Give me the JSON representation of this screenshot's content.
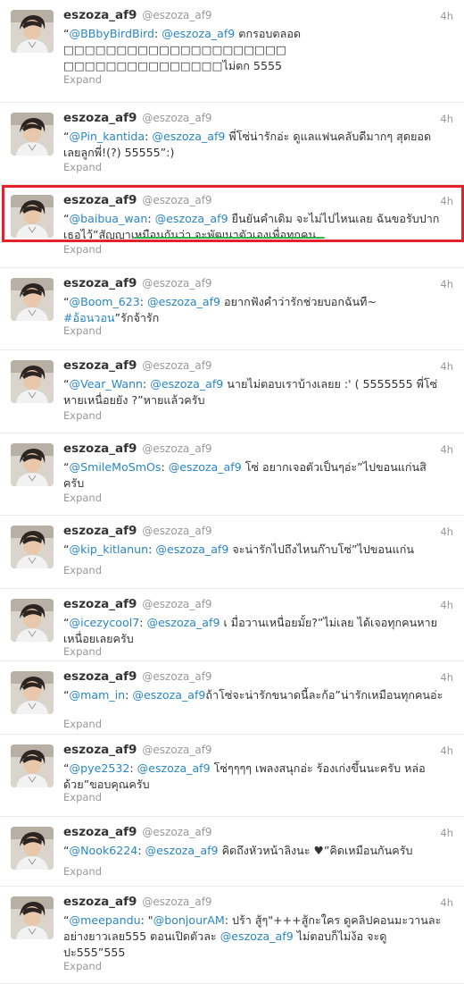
{
  "tweets": [
    {
      "name": "eszoza_af9",
      "handle": "@eszoza_af9",
      "time": "4h",
      "expand": "Expand",
      "lines": [
        [
          {
            "t": "“",
            "c": "p"
          },
          {
            "t": "@BBbyBirdBird",
            "c": "m"
          },
          {
            "t": ": ",
            "c": "p"
          },
          {
            "t": "@eszoza_af9",
            "c": "m"
          },
          {
            "t": " ตกรอบตลอด",
            "c": "p"
          }
        ],
        [
          {
            "t": "□□□□□□□□□□□□□□□□□□□□□",
            "c": "p"
          }
        ],
        [
          {
            "t": "□□□□□□□□□□□□□□□ไม่ตก 5555",
            "c": "p"
          }
        ]
      ]
    },
    {
      "name": "eszoza_af9",
      "handle": "@eszoza_af9",
      "time": "4h",
      "expand": "Expand",
      "lines": [
        [
          {
            "t": "“",
            "c": "p"
          },
          {
            "t": "@Pin_kantida",
            "c": "m"
          },
          {
            "t": ": ",
            "c": "p"
          },
          {
            "t": "@eszoza_af9",
            "c": "m"
          },
          {
            "t": " พี่โซ่น่ารักอ่ะ ดูแลแฟนคลับดีมากๆ สุดยอด",
            "c": "p"
          }
        ],
        [
          {
            "t": "เลยลูกพี่!(?) 55555”:)",
            "c": "p"
          }
        ]
      ]
    },
    {
      "name": "eszoza_af9",
      "handle": "@eszoza_af9",
      "time": "4h",
      "expand": "Expand",
      "lines": [
        [
          {
            "t": "“",
            "c": "p"
          },
          {
            "t": "@baibua_wan",
            "c": "m"
          },
          {
            "t": ": ",
            "c": "p"
          },
          {
            "t": "@eszoza_af9",
            "c": "m"
          },
          {
            "t": " ยืนยันคำเดิม จะไม่ไปไหนเลย ฉันขอรับปาก",
            "c": "p"
          }
        ],
        [
          {
            "t": "เธอไว้”สัญญาเหมือนกันว่า จะพัฒนาตัวเองเพื่อทุกคน",
            "c": "p"
          }
        ]
      ]
    },
    {
      "name": "eszoza_af9",
      "handle": "@eszoza_af9",
      "time": "4h",
      "expand": "Expand",
      "lines": [
        [
          {
            "t": "“",
            "c": "p"
          },
          {
            "t": "@Boom_623",
            "c": "m"
          },
          {
            "t": ": ",
            "c": "p"
          },
          {
            "t": "@eszoza_af9",
            "c": "m"
          },
          {
            "t": " อยากฟังคำว่ารักช่วยบอกฉันที~",
            "c": "p"
          }
        ],
        [
          {
            "t": "#อ้อนวอน",
            "c": "h"
          },
          {
            "t": "”รักจ้ารัก",
            "c": "p"
          }
        ]
      ]
    },
    {
      "name": "eszoza_af9",
      "handle": "@eszoza_af9",
      "time": "4h",
      "expand": "Expand",
      "lines": [
        [
          {
            "t": "“",
            "c": "p"
          },
          {
            "t": "@Vear_Wann",
            "c": "m"
          },
          {
            "t": ": ",
            "c": "p"
          },
          {
            "t": "@eszoza_af9",
            "c": "m"
          },
          {
            "t": " นายไม่ตอบเราบ้างเลยย :' ( 5555555 พี่โซ่",
            "c": "p"
          }
        ],
        [
          {
            "t": "หายเหนื่อยยัง ?”หายแล้วครับ",
            "c": "p"
          }
        ]
      ]
    },
    {
      "name": "eszoza_af9",
      "handle": "@eszoza_af9",
      "time": "4h",
      "expand": "Expand",
      "lines": [
        [
          {
            "t": "“",
            "c": "p"
          },
          {
            "t": "@SmileMoSmOs",
            "c": "m"
          },
          {
            "t": ": ",
            "c": "p"
          },
          {
            "t": "@eszoza_af9",
            "c": "m"
          },
          {
            "t": " โซ่ อยากเจอตัวเป็นๆอ่ะ”ไปขอนแก่นสิ",
            "c": "p"
          }
        ],
        [
          {
            "t": "ครับ",
            "c": "p"
          }
        ]
      ]
    },
    {
      "name": "eszoza_af9",
      "handle": "@eszoza_af9",
      "time": "4h",
      "expand": "Expand",
      "lines": [
        [
          {
            "t": "“",
            "c": "p"
          },
          {
            "t": "@kip_kitlanun",
            "c": "m"
          },
          {
            "t": ": ",
            "c": "p"
          },
          {
            "t": "@eszoza_af9",
            "c": "m"
          },
          {
            "t": " จะน่ารักไปถึงไหนก๊าบโซ่”ไปขอนแก่น",
            "c": "p"
          }
        ]
      ]
    },
    {
      "name": "eszoza_af9",
      "handle": "@eszoza_af9",
      "time": "4h",
      "expand": "Expand",
      "lines": [
        [
          {
            "t": "“",
            "c": "p"
          },
          {
            "t": "@icezycool7",
            "c": "m"
          },
          {
            "t": ": ",
            "c": "p"
          },
          {
            "t": "@eszoza_af9",
            "c": "m"
          },
          {
            "t": " เ มื่อวานเหนื่อยมั้ย?”ไม่เลย ได้เจอทุกคนหาย",
            "c": "p"
          }
        ],
        [
          {
            "t": "เหนื่อยเลยครับ",
            "c": "p"
          }
        ]
      ]
    },
    {
      "name": "eszoza_af9",
      "handle": "@eszoza_af9",
      "time": "4h",
      "expand": "Expand",
      "lines": [
        [
          {
            "t": "“",
            "c": "p"
          },
          {
            "t": "@mam_in",
            "c": "m"
          },
          {
            "t": ": ",
            "c": "p"
          },
          {
            "t": "@eszoza_af9",
            "c": "m"
          },
          {
            "t": "ถ้าโซ่จะน่ารักขนาดนี้ละก้อ”น่ารักเหมือนทุกคนอ่ะ",
            "c": "p"
          }
        ]
      ]
    },
    {
      "name": "eszoza_af9",
      "handle": "@eszoza_af9",
      "time": "4h",
      "expand": "Expand",
      "lines": [
        [
          {
            "t": "“",
            "c": "p"
          },
          {
            "t": "@pye2532",
            "c": "m"
          },
          {
            "t": ": ",
            "c": "p"
          },
          {
            "t": "@eszoza_af9",
            "c": "m"
          },
          {
            "t": " โซ่ๆๆๆๆ เพลงสนุกอ่ะ ร้องเก่งขึ้นนะครับ หล่อ",
            "c": "p"
          }
        ],
        [
          {
            "t": "ด้วย”ขอบคุณครับ",
            "c": "p"
          }
        ]
      ]
    },
    {
      "name": "eszoza_af9",
      "handle": "@eszoza_af9",
      "time": "4h",
      "expand": "Expand",
      "lines": [
        [
          {
            "t": "“",
            "c": "p"
          },
          {
            "t": "@Nook6224",
            "c": "m"
          },
          {
            "t": ": ",
            "c": "p"
          },
          {
            "t": "@eszoza_af9",
            "c": "m"
          },
          {
            "t": " คิดถึงหัวหน้าลิงนะ ♥”คิดเหมือนกันครับ",
            "c": "p"
          }
        ]
      ]
    },
    {
      "name": "eszoza_af9",
      "handle": "@eszoza_af9",
      "time": "4h",
      "expand": "Expand",
      "lines": [
        [
          {
            "t": "“",
            "c": "p"
          },
          {
            "t": "@meepandu",
            "c": "m"
          },
          {
            "t": ": \"",
            "c": "p"
          },
          {
            "t": "@bonjourAM",
            "c": "m"
          },
          {
            "t": ": ปร้า สู้ๆ\"+++สู้กะใคร ดูคลิปคอนมะวานละ",
            "c": "p"
          }
        ],
        [
          {
            "t": "อย่างยาวเลย555 ตอนเปิดตัวละ ",
            "c": "p"
          },
          {
            "t": "@eszoza_af9",
            "c": "m"
          },
          {
            "t": " ไม่ตอบก็ไม่ง้อ จะดู",
            "c": "p"
          }
        ],
        [
          {
            "t": "ปะ555”555",
            "c": "p"
          }
        ]
      ]
    }
  ],
  "colors": {
    "link": "#2a86c4",
    "highlight_box": "#e4222b",
    "underline": "#2db34a"
  }
}
